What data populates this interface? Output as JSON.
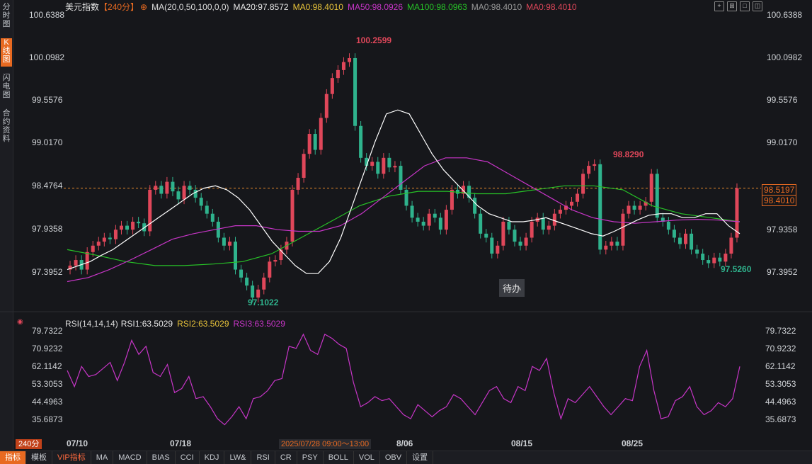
{
  "side_tabs": [
    {
      "label": "分时图"
    },
    {
      "label": "K线图"
    },
    {
      "label": "闪电图"
    },
    {
      "label": "合约资料"
    }
  ],
  "legend": {
    "name": "美元指数",
    "period": "【240分】",
    "params": "MA(20,0,50,100,0,0)",
    "ma20": "MA20:97.8572",
    "ma0a": "MA0:98.4010",
    "ma50": "MA50:98.0926",
    "ma100": "MA100:98.0963",
    "ma0b": "MA0:98.4010",
    "ma0c": "MA0:98.4010"
  },
  "colors": {
    "up": "#e0475a",
    "down": "#2fb38d",
    "ma20": "#ffffff",
    "ma50": "#c735c7",
    "ma100": "#27c227",
    "rsi": "#c735c7",
    "dash": "#e88a2c"
  },
  "price_axis": [
    "100.6388",
    "100.0982",
    "99.5576",
    "99.0170",
    "98.4764",
    "97.9358",
    "97.3952"
  ],
  "tags": {
    "current": "98.5197",
    "ma": "98.4010"
  },
  "annotations": {
    "high": "100.2599",
    "low": "97.1022",
    "local_high": "98.8290",
    "recent_low": "97.5260"
  },
  "popup": "待办",
  "rsi_legend": {
    "main": "RSI(14,14,14)",
    "r1": "RSI1:63.5029",
    "r2": "RSI2:63.5029",
    "r3": "RSI3:63.5029"
  },
  "rsi_axis": [
    "79.7322",
    "70.9232",
    "62.1142",
    "53.3053",
    "44.4963",
    "35.6873"
  ],
  "date_labels": [
    "07/10",
    "07/18",
    "8/06",
    "08/15",
    "08/25"
  ],
  "period_label": "240分",
  "time_box": "2025/07/28 09:00～13:00",
  "bottom_tabs": [
    "指标",
    "模板",
    "VIP指标",
    "MA",
    "MACD",
    "BIAS",
    "CCI",
    "KDJ",
    "LW&",
    "RSI",
    "CR",
    "PSY",
    "BOLL",
    "VOL",
    "OBV",
    "设置"
  ],
  "chart_data": {
    "type": "candlestick",
    "y_range": [
      97.15,
      100.7
    ],
    "close": [
      97.55,
      97.62,
      97.5,
      97.72,
      97.8,
      97.85,
      97.9,
      97.88,
      98.0,
      98.05,
      98.0,
      98.1,
      98.08,
      97.98,
      98.5,
      98.55,
      98.45,
      98.6,
      98.48,
      98.38,
      98.55,
      98.5,
      98.4,
      98.3,
      98.2,
      98.1,
      97.9,
      97.8,
      97.85,
      97.5,
      97.4,
      97.3,
      97.15,
      97.25,
      97.4,
      97.6,
      97.62,
      97.75,
      97.85,
      98.5,
      98.65,
      98.95,
      99.2,
      99.0,
      99.4,
      99.7,
      99.9,
      100.0,
      100.1,
      100.15,
      99.3,
      98.9,
      98.8,
      98.85,
      98.7,
      98.9,
      98.78,
      98.8,
      98.5,
      98.3,
      98.15,
      98.1,
      98.05,
      98.2,
      98.15,
      98.0,
      98.25,
      98.5,
      98.45,
      98.55,
      98.4,
      98.2,
      97.95,
      97.9,
      97.7,
      97.8,
      98.1,
      98.0,
      97.85,
      97.8,
      97.9,
      98.1,
      98.15,
      98.0,
      98.05,
      98.2,
      98.25,
      98.3,
      98.35,
      98.45,
      98.7,
      98.8,
      98.82,
      97.75,
      97.8,
      97.85,
      97.8,
      98.2,
      98.3,
      98.25,
      98.3,
      98.35,
      98.7,
      98.15,
      98.1,
      98.0,
      97.9,
      97.82,
      97.95,
      97.75,
      97.7,
      97.62,
      97.58,
      97.65,
      97.6,
      97.7,
      97.9,
      98.52
    ],
    "ma20": [
      97.5,
      97.55,
      97.6,
      97.68,
      97.75,
      97.85,
      97.95,
      98.05,
      98.15,
      98.25,
      98.35,
      98.45,
      98.52,
      98.55,
      98.5,
      98.4,
      98.25,
      98.05,
      97.85,
      97.7,
      97.55,
      97.45,
      97.45,
      97.6,
      97.9,
      98.3,
      98.7,
      99.1,
      99.45,
      99.5,
      99.45,
      99.2,
      98.95,
      98.75,
      98.6,
      98.45,
      98.3,
      98.2,
      98.15,
      98.1,
      98.1,
      98.12,
      98.15,
      98.1,
      98.05,
      98.0,
      97.95,
      97.92,
      97.98,
      98.05,
      98.12,
      98.18,
      98.2,
      98.2,
      98.15,
      98.15,
      98.2,
      98.2,
      98.05,
      97.95
    ],
    "ma50": [
      97.35,
      97.4,
      97.5,
      97.62,
      97.75,
      97.88,
      97.95,
      98.0,
      98.05,
      98.05,
      98.0,
      97.98,
      97.98,
      98.05,
      98.2,
      98.4,
      98.6,
      98.8,
      98.9,
      98.9,
      98.85,
      98.7,
      98.55,
      98.4,
      98.25,
      98.15,
      98.1,
      98.08,
      98.1,
      98.12,
      98.13,
      98.12,
      98.1
    ],
    "ma100": [
      97.75,
      97.68,
      97.6,
      97.55,
      97.55,
      97.57,
      97.6,
      97.7,
      97.9,
      98.1,
      98.3,
      98.42,
      98.48,
      98.48,
      98.45,
      98.45,
      98.5,
      98.55,
      98.55,
      98.5,
      98.3,
      98.2,
      98.15,
      98.1
    ],
    "rsi": [
      60,
      52,
      62,
      57,
      58,
      61,
      64,
      55,
      64,
      75,
      68,
      72,
      59,
      57,
      63,
      49,
      51,
      57,
      46,
      47,
      42,
      36,
      33,
      37,
      42,
      36,
      46,
      47,
      50,
      55,
      56,
      72,
      71,
      78,
      70,
      68,
      78,
      76,
      73,
      71,
      54,
      42,
      44,
      47,
      45,
      46,
      42,
      38,
      36,
      43,
      40,
      37,
      40,
      42,
      48,
      46,
      42,
      38,
      44,
      50,
      52,
      46,
      44,
      52,
      50,
      62,
      60,
      66,
      49,
      36,
      46,
      44,
      48,
      52,
      47,
      42,
      38,
      42,
      46,
      45,
      62,
      70,
      50,
      36,
      37,
      45,
      47,
      52,
      42,
      38,
      40,
      44,
      42,
      46,
      62
    ]
  }
}
